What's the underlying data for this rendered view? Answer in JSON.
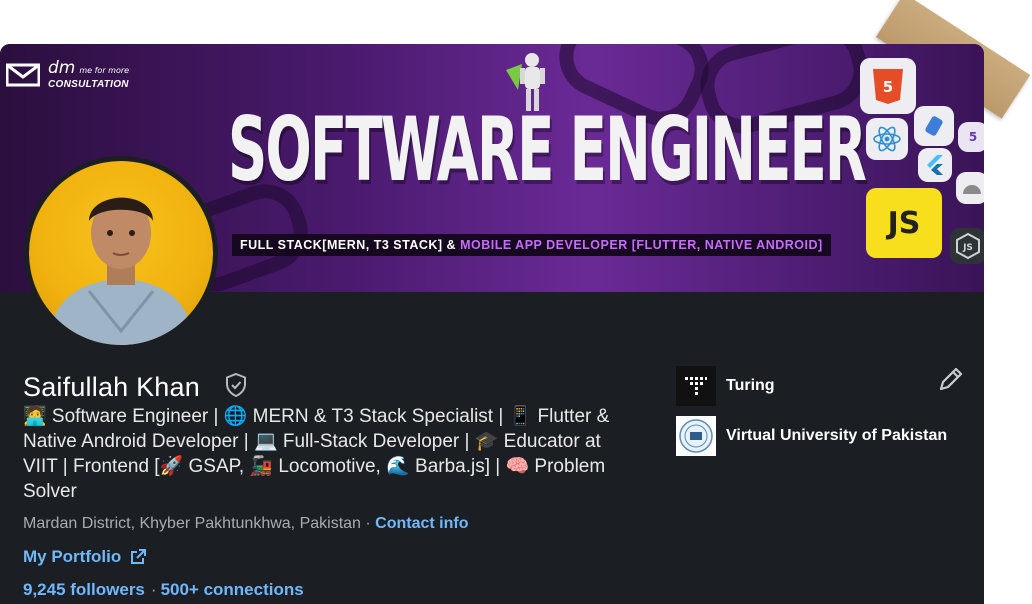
{
  "banner": {
    "dm_main": "dm",
    "dm_small": "me for more",
    "dm_sub": "CONSULTATION",
    "headline": "SOFTWARE ENGINEER",
    "sub_white": "FULL STACK[MERN, T3 STACK] &",
    "sub_accent": "MOBILE APP DEVELOPER [FLUTTER, NATIVE ANDROID]",
    "tech_icons": [
      "html5-icon",
      "react-icon",
      "redux-icon",
      "flutter-icon",
      "android-icon",
      "javascript-icon",
      "nodejs-icon"
    ],
    "js_label": "JS"
  },
  "profile": {
    "name": "Saifullah Khan",
    "bio": "🧑‍💻 Software Engineer | 🌐 MERN & T3 Stack Specialist | 📱 Flutter & Native Android Developer | 💻 Full-Stack Developer | 🎓 Educator at VIIT | Frontend [🚀 GSAP, 🚂 Locomotive, 🌊 Barba.js] | 🧠 Problem Solver",
    "location": "Mardan District, Khyber Pakhtunkhwa, Pakistan",
    "location_sep": " · ",
    "contact_info": "Contact info",
    "portfolio": "My Portfolio",
    "followers": "9,245 followers",
    "connections": "500+ connections",
    "stats_sep": "·"
  },
  "organizations": [
    {
      "name": "Turing"
    },
    {
      "name": "Virtual University of Pakistan"
    }
  ],
  "colors": {
    "card_bg": "#1b1f23",
    "link": "#71b7fb",
    "banner_purple": "#4a1a6e",
    "avatar_ring": "#f0b10f"
  }
}
